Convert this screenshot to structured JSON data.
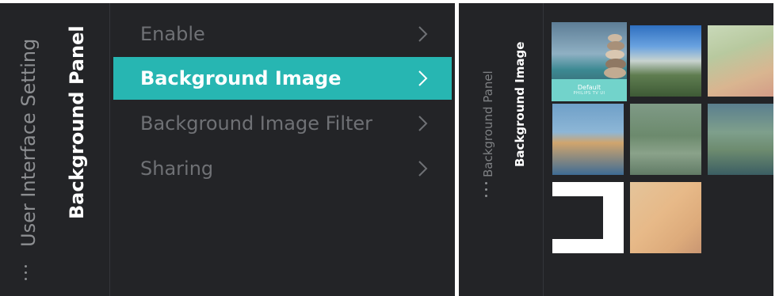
{
  "left_panel": {
    "breadcrumb_parent": "User Interface Setting",
    "title": "Background Panel",
    "menu": [
      {
        "label": "Enable",
        "selected": false
      },
      {
        "label": "Background Image",
        "selected": true
      },
      {
        "label": "Background Image Filter",
        "selected": false
      },
      {
        "label": "Sharing",
        "selected": false
      }
    ],
    "chevron_icon": "chevron-right-icon"
  },
  "right_panel": {
    "breadcrumb_parent": "Background Panel",
    "title": "Background Image",
    "default_thumb": {
      "badge_label": "Default",
      "badge_sublabel": "PHILIPS TV UI"
    },
    "thumbnails": [
      {
        "name": "default-beach-stones",
        "selected": true
      },
      {
        "name": "blue-sky-green-field",
        "selected": false
      },
      {
        "name": "soft-green-peach",
        "selected": false
      },
      {
        "name": "blue-amber-horizon",
        "selected": false
      },
      {
        "name": "green-grey-blur",
        "selected": false
      },
      {
        "name": "teal-green-amber",
        "selected": false
      },
      {
        "name": "white-frame",
        "selected": false
      },
      {
        "name": "peach-gradient",
        "selected": false
      }
    ]
  },
  "colors": {
    "panel_bg": "#232427",
    "accent": "#27b6b2",
    "text_dim": "#6f7175",
    "text_bright": "#ffffff",
    "badge": "#72d3cb"
  }
}
